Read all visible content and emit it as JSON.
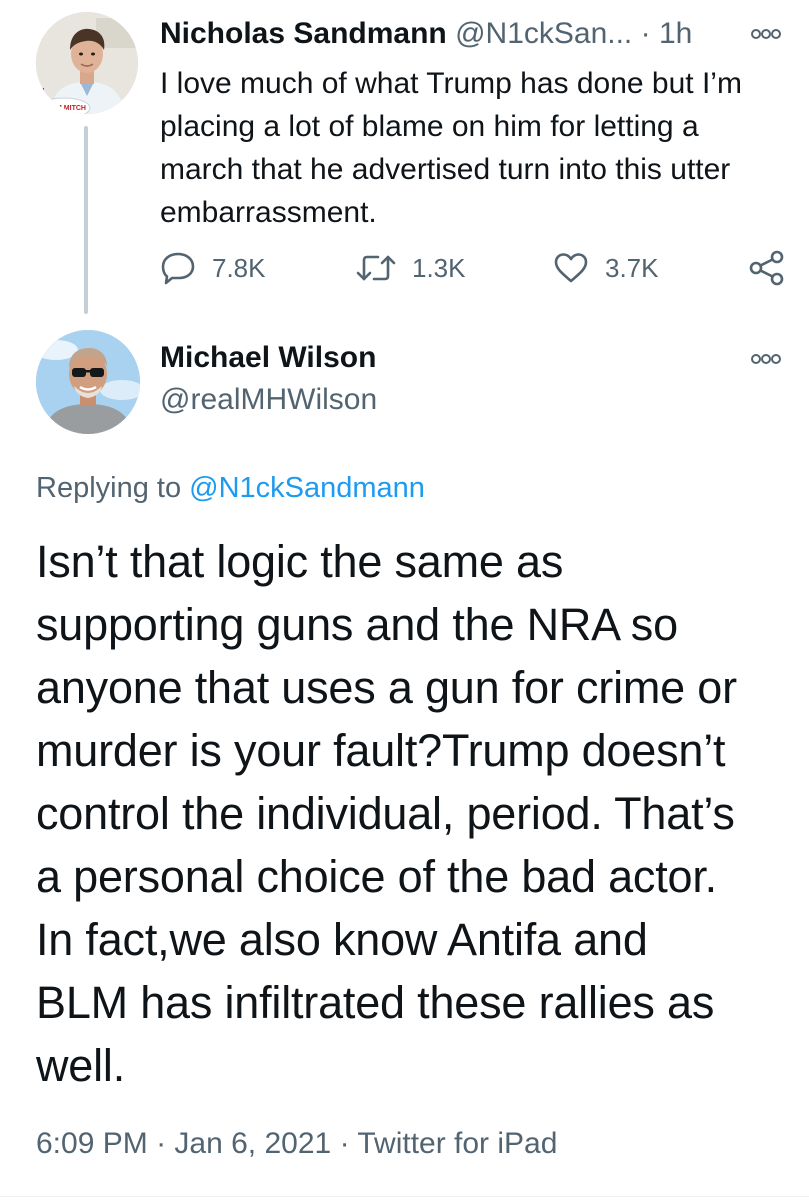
{
  "parent_tweet": {
    "display_name": "Nicholas Sandmann",
    "handle": "@N1ckSan...",
    "separator": "·",
    "time": "1h",
    "text_lines": [
      "I love much of what Trump has done but I’m",
      "placing a lot of blame on him for letting a",
      "march that he advertised turn into this utter",
      "embarrassment."
    ],
    "avatar_badge": "TEAM MITCH",
    "reply_count": "7.8K",
    "retweet_count": "1.3K",
    "like_count": "3.7K",
    "icons": [
      "reply-icon",
      "retweet-icon",
      "like-icon",
      "share-icon",
      "more-icon"
    ]
  },
  "reply_tweet": {
    "display_name": "Michael Wilson",
    "handle": "@realMHWilson",
    "replying_to_prefix": "Replying to",
    "replying_to_handle": "@N1ckSandmann",
    "text_lines": [
      "Isn’t that logic the same as",
      "supporting guns and the NRA so",
      "anyone that uses a gun for crime or",
      "murder is your fault?Trump doesn’t",
      "control the individual, period. That’s",
      "a personal choice of the bad actor.",
      "In fact,we also know Antifa and",
      "BLM has infiltrated these rallies as",
      "well."
    ],
    "time": "6:09 PM",
    "date": "Jan 6, 2021",
    "source": "Twitter for iPad",
    "meta_separator": "·"
  },
  "colors": {
    "text_primary": "#0f1419",
    "text_secondary": "#536471",
    "link": "#1d9bf0",
    "thread_line": "#c4cfd6"
  }
}
